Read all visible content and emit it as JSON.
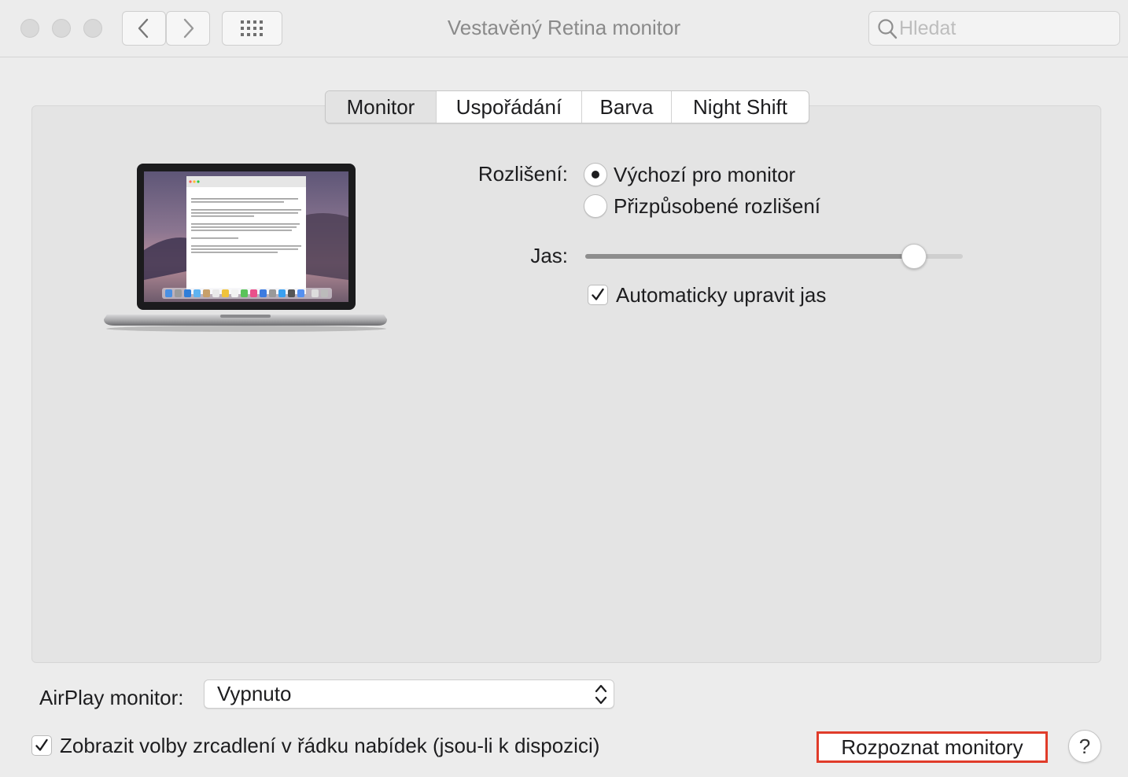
{
  "window": {
    "title": "Vestavěný Retina monitor",
    "search_placeholder": "Hledat"
  },
  "toolbar": {
    "icons": [
      "close-light",
      "minimize-light",
      "zoom-light",
      "chevron-left-icon",
      "chevron-right-icon",
      "grid-icon",
      "search-icon"
    ]
  },
  "tabs": [
    {
      "label": "Monitor",
      "active": true
    },
    {
      "label": "Uspořádání",
      "active": false
    },
    {
      "label": "Barva",
      "active": false
    },
    {
      "label": "Night Shift",
      "active": false
    }
  ],
  "display": {
    "resolution_label": "Rozlišení:",
    "resolution_options": [
      {
        "label": "Výchozí pro monitor",
        "selected": true
      },
      {
        "label": "Přizpůsobené rozlišení",
        "selected": false
      }
    ],
    "brightness_label": "Jas:",
    "brightness_value": 0.87,
    "auto_brightness_label": "Automaticky upravit jas",
    "auto_brightness_checked": true
  },
  "footer": {
    "airplay_label": "AirPlay monitor:",
    "airplay_value": "Vypnuto",
    "mirroring_label": "Zobrazit volby zrcadlení v řádku nabídek (jsou-li k dispozici)",
    "mirroring_checked": true,
    "detect_button": "Rozpoznat monitory",
    "help_button": "?"
  },
  "colors": {
    "window_bg": "#ececec",
    "panel_bg": "#e4e4e4",
    "highlight_border": "#e03c2a"
  }
}
